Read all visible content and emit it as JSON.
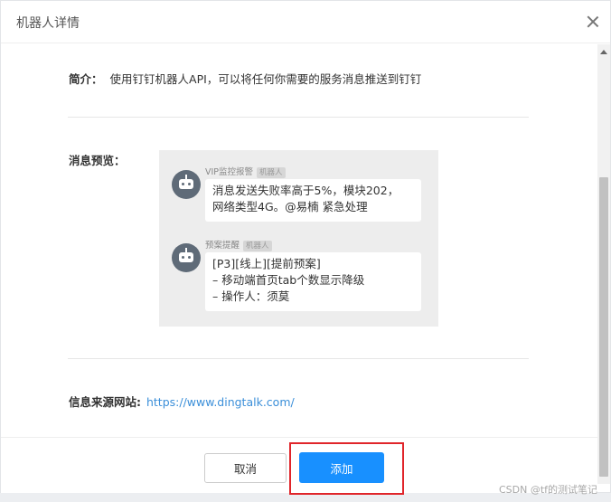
{
  "dialog": {
    "title": "机器人详情"
  },
  "intro": {
    "label": "简介：",
    "text": "使用钉钉机器人API，可以将任何你需要的服务消息推送到钉钉"
  },
  "preview": {
    "label": "消息预览：",
    "messages": [
      {
        "sender": "VIP监控报警",
        "tag": "机器人",
        "lines": [
          "消息发送失败率高于5%，模块202，",
          "网络类型4G。@易楠 紧急处理"
        ]
      },
      {
        "sender": "预案提醒",
        "tag": "机器人",
        "lines": [
          "[P3][线上][提前预案]",
          "– 移动端首页tab个数显示降级",
          "– 操作人：须莫"
        ]
      }
    ]
  },
  "source": {
    "label": "信息来源网站:",
    "link": "https://www.dingtalk.com/"
  },
  "footer": {
    "cancel": "取消",
    "add": "添加"
  },
  "watermark": "CSDN @tf的测试笔记",
  "colors": {
    "primary": "#1890ff",
    "highlight": "#e0252a",
    "link": "#3b8fd9"
  },
  "icons": {
    "close": "close-icon",
    "avatar": "robot-avatar-icon"
  }
}
